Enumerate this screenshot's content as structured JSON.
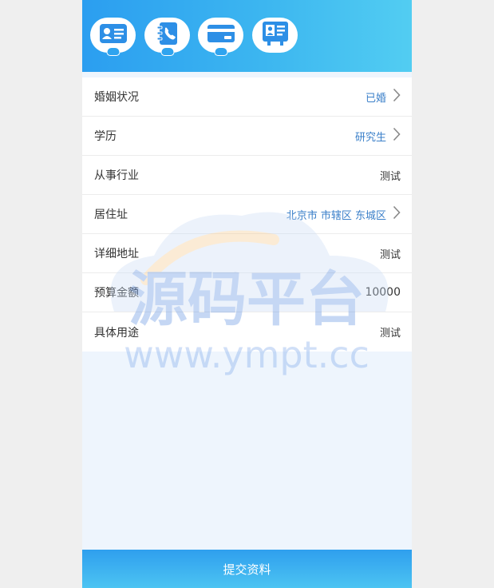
{
  "steps": [
    {
      "icon": "id-card-icon"
    },
    {
      "icon": "phone-contact-icon"
    },
    {
      "icon": "bank-card-icon"
    },
    {
      "icon": "profile-card-icon"
    }
  ],
  "form": {
    "marital_status": {
      "label": "婚姻状况",
      "value": "已婚"
    },
    "education": {
      "label": "学历",
      "value": "研究生"
    },
    "industry": {
      "label": "从事行业",
      "value": "测试"
    },
    "residence": {
      "label": "居住址",
      "value": "北京市 市辖区 东城区"
    },
    "address_detail": {
      "label": "详细地址",
      "value": "测试"
    },
    "budget": {
      "label": "预算金额",
      "value": "10000"
    },
    "purpose": {
      "label": "具体用途",
      "value": "测试"
    }
  },
  "watermark": {
    "text_cn": "源码平台",
    "text_en": "www.ympt.cc"
  },
  "submit_label": "提交资料",
  "colors": {
    "accent": "#2b9ef0",
    "link": "#3a7fc9"
  }
}
